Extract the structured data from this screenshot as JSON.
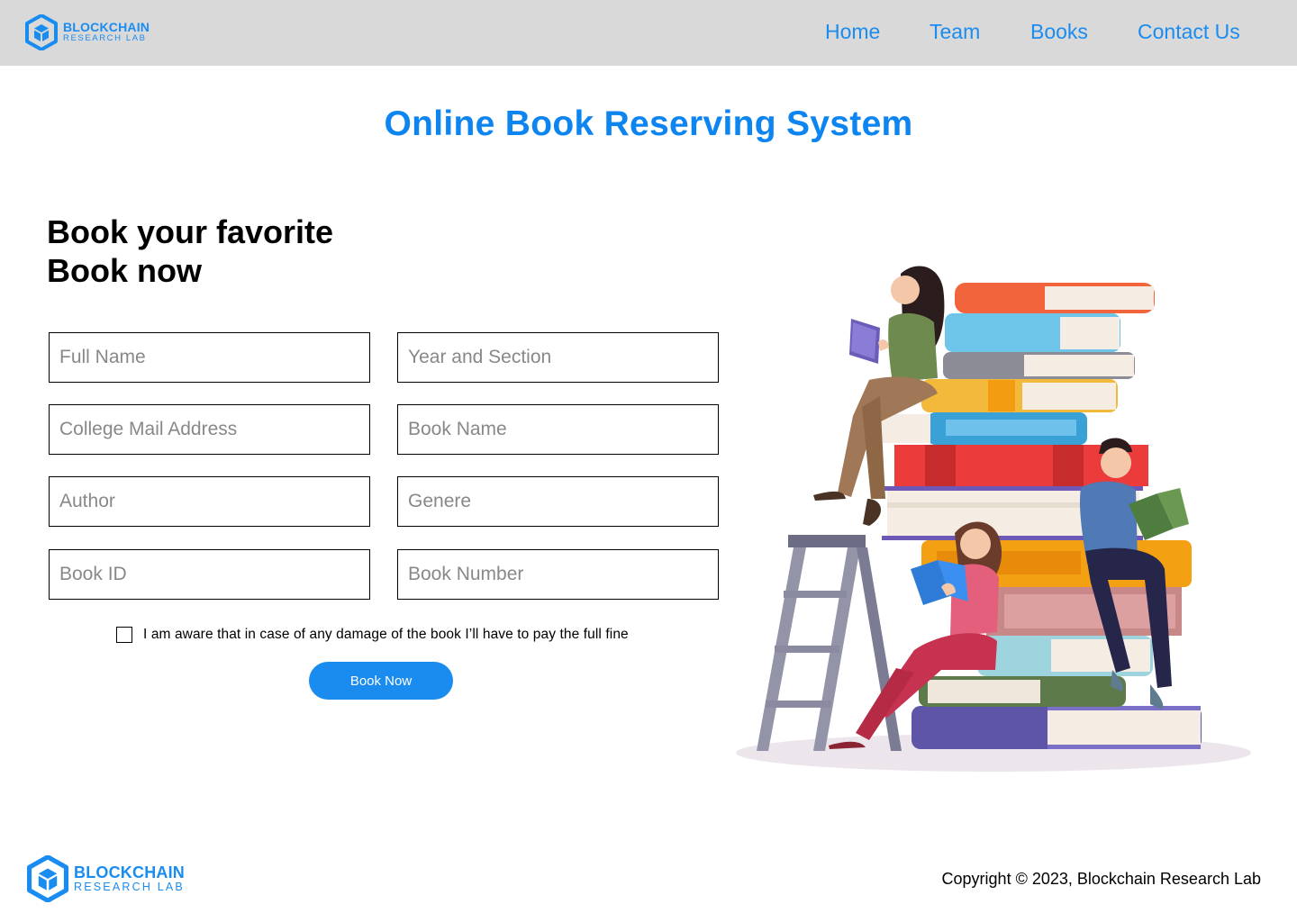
{
  "brand": {
    "name": "BLOCKCHAIN",
    "tagline": "RESEARCH LAB"
  },
  "nav": {
    "items": [
      "Home",
      "Team",
      "Books",
      "Contact Us"
    ]
  },
  "page_title": "Online Book Reserving System",
  "heading": {
    "line1": "Book your favorite",
    "line2": "Book now"
  },
  "form": {
    "fields": [
      {
        "placeholder": "Full Name",
        "value": ""
      },
      {
        "placeholder": "Year and Section",
        "value": ""
      },
      {
        "placeholder": "College Mail Address",
        "value": ""
      },
      {
        "placeholder": "Book Name",
        "value": ""
      },
      {
        "placeholder": "Author",
        "value": ""
      },
      {
        "placeholder": "Genere",
        "value": ""
      },
      {
        "placeholder": "Book ID",
        "value": ""
      },
      {
        "placeholder": "Book Number",
        "value": ""
      }
    ],
    "agree_label": "I am aware that in case of any damage of the book I’ll have to pay the full fine",
    "agree_checked": false,
    "submit_label": "Book Now"
  },
  "footer": {
    "copyright": "Copyright © 2023, Blockchain Research Lab"
  },
  "colors": {
    "accent": "#1a8cf0",
    "nav_bg": "#d9d9d9",
    "title": "#0d85f0"
  }
}
